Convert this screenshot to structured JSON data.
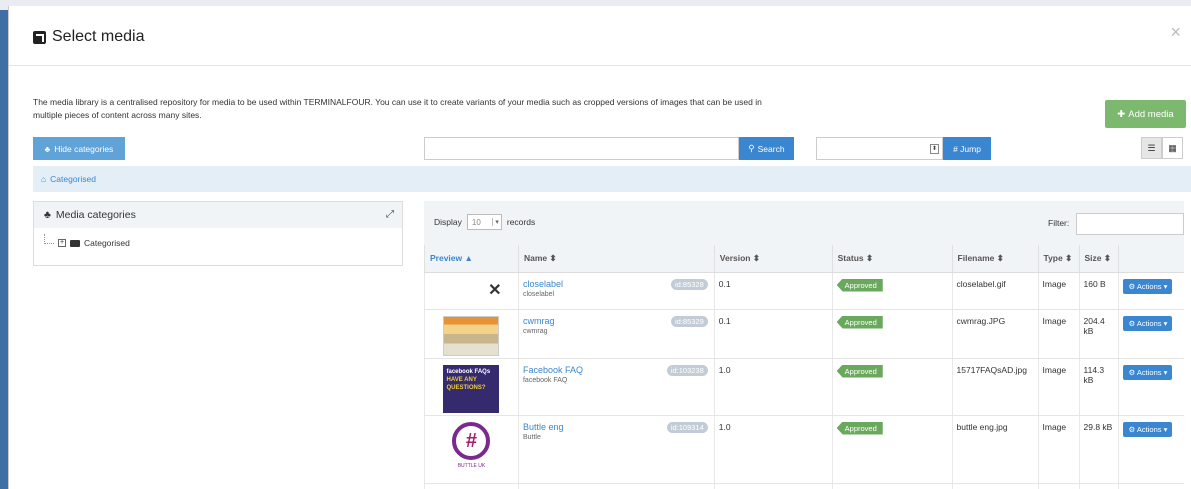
{
  "modal": {
    "title": "Select media",
    "close": "×",
    "intro": "The media library is a centralised repository for media to be used within TERMINALFOUR. You can use it to create variants of your media such as cropped versions of images that can be used in multiple pieces of content across many sites."
  },
  "toolbar": {
    "add_media": "Add media",
    "hide_categories": "Hide categories",
    "search_value": "",
    "search_label": "Search",
    "jump_value": "",
    "jump_label": "# Jump"
  },
  "breadcrumb": {
    "label": "Categorised"
  },
  "categories": {
    "title": "Media categories",
    "tree_root": "Categorised"
  },
  "grid": {
    "display_label": "Display",
    "display_value": "10",
    "records_label": "records",
    "filter_label": "Filter:",
    "filter_value": "",
    "columns": [
      "Preview ▲",
      "Name ⬍",
      "Version ⬍",
      "Status ⬍",
      "Filename ⬍",
      "Type ⬍",
      "Size ⬍"
    ],
    "rows": [
      {
        "name": "closelabel",
        "sub": "closelabel",
        "id": "id:85328",
        "version": "0.1",
        "status": "Approved",
        "filename": "closelabel.gif",
        "type": "Image",
        "size": "160 B",
        "action": "Actions ▾",
        "thumb": "close"
      },
      {
        "name": "cwmrag",
        "sub": "cwmrag",
        "id": "id:85329",
        "version": "0.1",
        "status": "Approved",
        "filename": "cwmrag.JPG",
        "type": "Image",
        "size": "204.4 kB",
        "action": "Actions ▾",
        "thumb": "cwm"
      },
      {
        "name": "Facebook FAQ",
        "sub": "facebook FAQ",
        "id": "id:103238",
        "version": "1.0",
        "status": "Approved",
        "filename": "15717FAQsAD.jpg",
        "type": "Image",
        "size": "114.3 kB",
        "action": "Actions ▾",
        "thumb": "fb"
      },
      {
        "name": "Buttle eng",
        "sub": "Buttle",
        "id": "id:109314",
        "version": "1.0",
        "status": "Approved",
        "filename": "buttle eng.jpg",
        "type": "Image",
        "size": "29.8 kB",
        "action": "Actions ▾",
        "thumb": "logo"
      }
    ],
    "thumb_text": {
      "fb_line1": "facebook FAQs",
      "fb_line2": "HAVE ANY",
      "fb_line3": "QUESTIONS?",
      "logo_caption": "BUTTLE UK"
    }
  },
  "colors": {
    "accent": "#3b86d0",
    "success": "#6aa85e",
    "add": "#7cb96f"
  }
}
